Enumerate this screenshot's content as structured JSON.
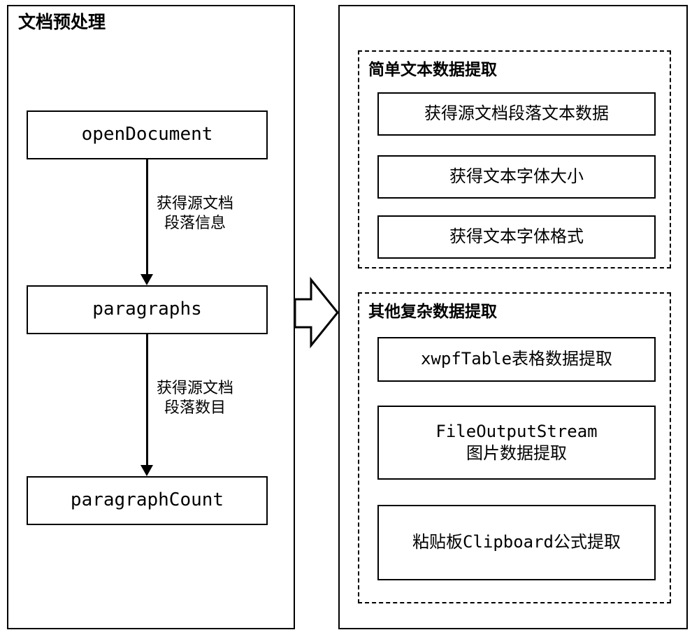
{
  "left_panel": {
    "title": "文档预处理",
    "step1": "openDocument",
    "arrow1_label_line1": "获得源文档",
    "arrow1_label_line2": "段落信息",
    "step2": "paragraphs",
    "arrow2_label_line1": "获得源文档",
    "arrow2_label_line2": "段落数目",
    "step3": "paragraphCount"
  },
  "right_panel": {
    "group1": {
      "title": "简单文本数据提取",
      "item1": "获得源文档段落文本数据",
      "item2": "获得文本字体大小",
      "item3": "获得文本字体格式"
    },
    "group2": {
      "title": "其他复杂数据提取",
      "item1": "xwpfTable表格数据提取",
      "item2_line1": "FileOutputStream",
      "item2_line2": "图片数据提取",
      "item3": "粘贴板Clipboard公式提取"
    }
  }
}
